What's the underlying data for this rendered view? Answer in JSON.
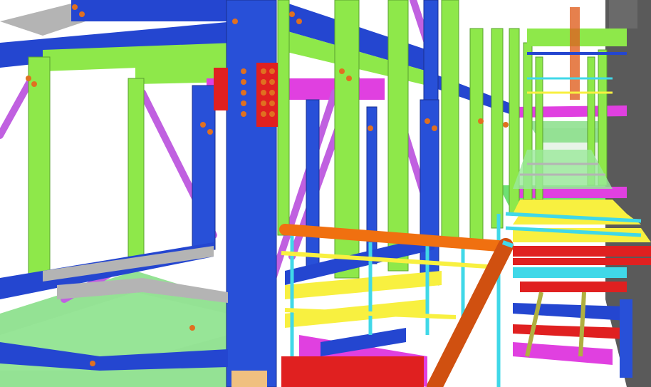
{
  "scene": {
    "description_visible_text": "",
    "colors": {
      "background": "#ffffff",
      "column_green": "#8ee84a",
      "column_blue": "#2850d8",
      "beam_gray": "#b4b4b4",
      "beam_blue": "#2446d0",
      "brace_purple": "#c060e0",
      "beam_magenta": "#e040e0",
      "grating_yellow": "#f8f040",
      "handrail_cyan": "#40d8e8",
      "handrail_orange": "#f07010",
      "beam_red": "#e02020",
      "floor_glass_green": "#70d870",
      "wall_dark": "#5a5a5a",
      "bolt_orange": "#e07020"
    }
  }
}
